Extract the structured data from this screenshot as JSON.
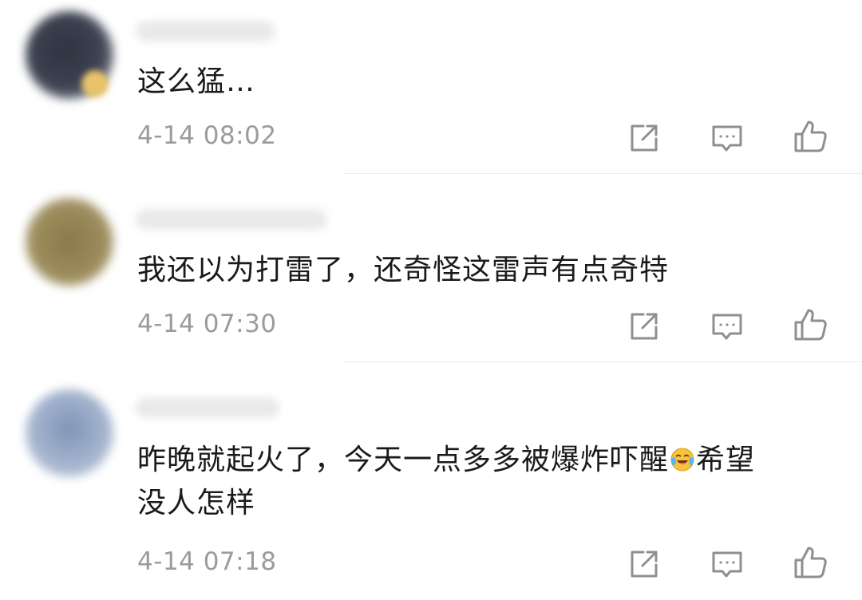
{
  "comments": [
    {
      "text": "这么猛…",
      "time": "4-14 08:02"
    },
    {
      "text": "我还以为打雷了，还奇怪这雷声有点奇特",
      "time": "4-14 07:30"
    },
    {
      "text_before_emoji": "昨晚就起火了，今天一点多多被爆炸吓醒",
      "emoji": "crying-laughing-emoji",
      "text_after_emoji_line1": "希望",
      "text_line2": "没人怎样",
      "time": "4-14 07:18"
    }
  ],
  "icons": {
    "share": "share-icon",
    "reply": "comment-icon",
    "like": "thumbs-up-icon"
  },
  "colors": {
    "text": "#1a1a1a",
    "meta": "#9b9b9b",
    "icon": "#8f8f8f",
    "divider": "#ececec"
  }
}
